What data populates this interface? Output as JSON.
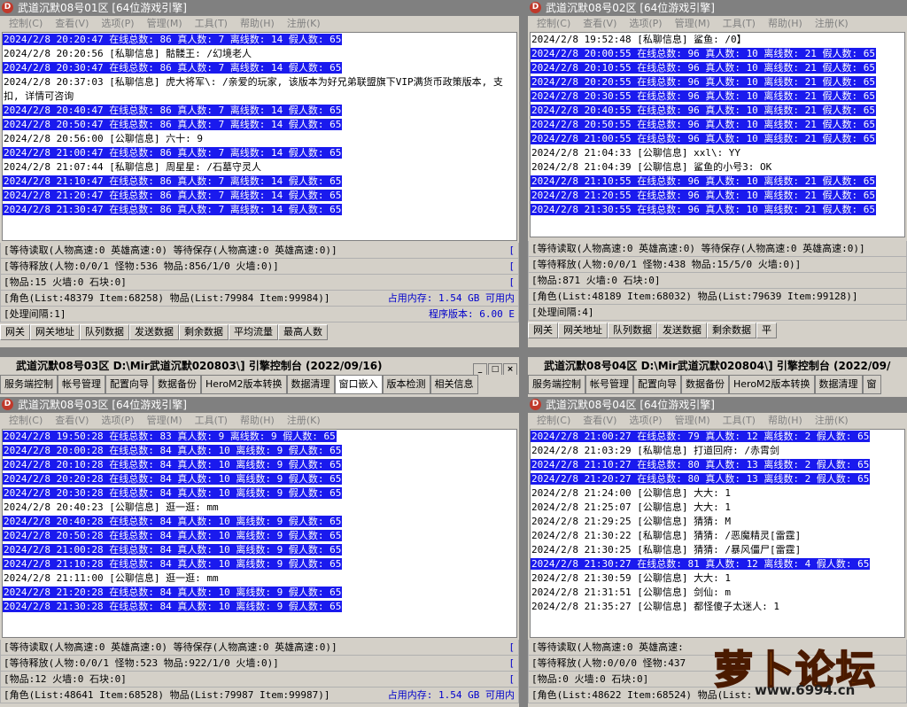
{
  "w1": {
    "title": "武道沉默08号01区 [64位游戏引擎]",
    "menu": [
      "控制(C)",
      "查看(V)",
      "选项(P)",
      "管理(M)",
      "工具(T)",
      "帮助(H)",
      "注册(K)"
    ],
    "log": [
      {
        "t": "2024/2/8 20:20:47 在线总数: 86 真人数: 7 离线数: 14 假人数: 65",
        "hl": true
      },
      {
        "t": "2024/2/8 20:20:56 [私聊信息] 骷髅王: /幻境老人",
        "hl": false
      },
      {
        "t": "2024/2/8 20:30:47 在线总数: 86 真人数: 7 离线数: 14 假人数: 65",
        "hl": true
      },
      {
        "t": "2024/2/8 20:37:03 [私聊信息] 虎大将军\\: /亲爱的玩家, 该版本为好兄弟联盟旗下VIP满货币政策版本, 支",
        "hl": false
      },
      {
        "t": "扣, 详情可咨询",
        "hl": false
      },
      {
        "t": "2024/2/8 20:40:47 在线总数: 86 真人数: 7 离线数: 14 假人数: 65",
        "hl": true
      },
      {
        "t": "2024/2/8 20:50:47 在线总数: 86 真人数: 7 离线数: 14 假人数: 65",
        "hl": true
      },
      {
        "t": "2024/2/8 20:56:00 [公聊信息] 六十: 9",
        "hl": false
      },
      {
        "t": "2024/2/8 21:00:47 在线总数: 86 真人数: 7 离线数: 14 假人数: 65",
        "hl": true
      },
      {
        "t": "2024/2/8 21:07:44 [私聊信息] 周星星: /石墓守灵人",
        "hl": false
      },
      {
        "t": "2024/2/8 21:10:47 在线总数: 86 真人数: 7 离线数: 14 假人数: 65",
        "hl": true
      },
      {
        "t": "2024/2/8 21:20:47 在线总数: 86 真人数: 7 离线数: 14 假人数: 65",
        "hl": true
      },
      {
        "t": "2024/2/8 21:30:47 在线总数: 86 真人数: 7 离线数: 14 假人数: 65",
        "hl": true
      }
    ],
    "status": [
      {
        "l": "[等待读取(人物高速:0 英雄高速:0) 等待保存(人物高速:0 英雄高速:0)]",
        "r": "["
      },
      {
        "l": "[等待释放(人物:0/0/1 怪物:536 物品:856/1/0 火墙:0)]",
        "r": "["
      },
      {
        "l": "[物品:15 火墙:0 石块:0]",
        "r": "["
      },
      {
        "l": "[角色(List:48379 Item:68258) 物品(List:79984 Item:99984)]",
        "r": "占用内存: 1.54 GB 可用内"
      },
      {
        "l": "[处理间隔:1]",
        "r": "程序版本: 6.00 E"
      }
    ],
    "cols": [
      "网关",
      "网关地址",
      "队列数据",
      "发送数据",
      "剩余数据",
      "平均流量",
      "最高人数"
    ]
  },
  "w2": {
    "title": "武道沉默08号02区 [64位游戏引擎]",
    "menu": [
      "控制(C)",
      "查看(V)",
      "选项(P)",
      "管理(M)",
      "工具(T)",
      "帮助(H)",
      "注册(K)"
    ],
    "log": [
      {
        "t": "2024/2/8 19:52:48 [私聊信息] 鲨鱼: /0】",
        "hl": false
      },
      {
        "t": "2024/2/8 20:00:55 在线总数: 96 真人数: 10 离线数: 21 假人数: 65",
        "hl": true
      },
      {
        "t": "2024/2/8 20:10:55 在线总数: 96 真人数: 10 离线数: 21 假人数: 65",
        "hl": true
      },
      {
        "t": "2024/2/8 20:20:55 在线总数: 96 真人数: 10 离线数: 21 假人数: 65",
        "hl": true
      },
      {
        "t": "2024/2/8 20:30:55 在线总数: 96 真人数: 10 离线数: 21 假人数: 65",
        "hl": true
      },
      {
        "t": "2024/2/8 20:40:55 在线总数: 96 真人数: 10 离线数: 21 假人数: 65",
        "hl": true
      },
      {
        "t": "2024/2/8 20:50:55 在线总数: 96 真人数: 10 离线数: 21 假人数: 65",
        "hl": true
      },
      {
        "t": "2024/2/8 21:00:55 在线总数: 96 真人数: 10 离线数: 21 假人数: 65",
        "hl": true
      },
      {
        "t": "2024/2/8 21:04:33 [公聊信息] xxl\\: YY",
        "hl": false
      },
      {
        "t": "2024/2/8 21:04:39 [公聊信息] 鲨鱼的小号3: OK",
        "hl": false
      },
      {
        "t": "2024/2/8 21:10:55 在线总数: 96 真人数: 10 离线数: 21 假人数: 65",
        "hl": true
      },
      {
        "t": "2024/2/8 21:20:55 在线总数: 96 真人数: 10 离线数: 21 假人数: 65",
        "hl": true
      },
      {
        "t": "2024/2/8 21:30:55 在线总数: 96 真人数: 10 离线数: 21 假人数: 65",
        "hl": true
      }
    ],
    "status": [
      {
        "l": "[等待读取(人物高速:0 英雄高速:0) 等待保存(人物高速:0 英雄高速:0)]",
        "r": ""
      },
      {
        "l": "[等待释放(人物:0/0/1 怪物:438 物品:15/5/0 火墙:0)]",
        "r": ""
      },
      {
        "l": "[物品:871 火墙:0 石块:0]",
        "r": ""
      },
      {
        "l": "[角色(List:48189 Item:68032) 物品(List:79639 Item:99128)]",
        "r": ""
      },
      {
        "l": "[处理间隔:4]",
        "r": ""
      }
    ],
    "cols": [
      "网关",
      "网关地址",
      "队列数据",
      "发送数据",
      "剩余数据",
      "平"
    ]
  },
  "w3": {
    "outer_title": "武道沉默08号03区 D:\\Mir武道沉默020803\\] 引擎控制台 (2022/09/16)",
    "tabs": [
      "服务端控制",
      "帐号管理",
      "配置向导",
      "数据备份",
      "HeroM2版本转换",
      "数据清理",
      "窗口嵌入",
      "版本检测",
      "相关信息"
    ],
    "title": "武道沉默08号03区 [64位游戏引擎]",
    "menu": [
      "控制(C)",
      "查看(V)",
      "选项(P)",
      "管理(M)",
      "工具(T)",
      "帮助(H)",
      "注册(K)"
    ],
    "log": [
      {
        "t": "2024/2/8 19:50:28 在线总数: 83 真人数: 9 离线数: 9 假人数: 65",
        "hl": true
      },
      {
        "t": "2024/2/8 20:00:28 在线总数: 84 真人数: 10 离线数: 9 假人数: 65",
        "hl": true
      },
      {
        "t": "2024/2/8 20:10:28 在线总数: 84 真人数: 10 离线数: 9 假人数: 65",
        "hl": true
      },
      {
        "t": "2024/2/8 20:20:28 在线总数: 84 真人数: 10 离线数: 9 假人数: 65",
        "hl": true
      },
      {
        "t": "2024/2/8 20:30:28 在线总数: 84 真人数: 10 离线数: 9 假人数: 65",
        "hl": true
      },
      {
        "t": "2024/2/8 20:40:23 [公聊信息] 逛一逛: mm",
        "hl": false
      },
      {
        "t": "2024/2/8 20:40:28 在线总数: 84 真人数: 10 离线数: 9 假人数: 65",
        "hl": true
      },
      {
        "t": "2024/2/8 20:50:28 在线总数: 84 真人数: 10 离线数: 9 假人数: 65",
        "hl": true
      },
      {
        "t": "2024/2/8 21:00:28 在线总数: 84 真人数: 10 离线数: 9 假人数: 65",
        "hl": true
      },
      {
        "t": "2024/2/8 21:10:28 在线总数: 84 真人数: 10 离线数: 9 假人数: 65",
        "hl": true
      },
      {
        "t": "2024/2/8 21:11:00 [公聊信息] 逛一逛: mm",
        "hl": false
      },
      {
        "t": "2024/2/8 21:20:28 在线总数: 84 真人数: 10 离线数: 9 假人数: 65",
        "hl": true
      },
      {
        "t": "2024/2/8 21:30:28 在线总数: 84 真人数: 10 离线数: 9 假人数: 65",
        "hl": true
      }
    ],
    "status": [
      {
        "l": "[等待读取(人物高速:0 英雄高速:0) 等待保存(人物高速:0 英雄高速:0)]",
        "r": "["
      },
      {
        "l": "[等待释放(人物:0/0/1 怪物:523 物品:922/1/0 火墙:0)]",
        "r": "["
      },
      {
        "l": "[物品:12 火墙:0 石块:0]",
        "r": "["
      },
      {
        "l": "[角色(List:48641 Item:68528) 物品(List:79987 Item:99987)]",
        "r": "占用内存: 1.54 GB 可用内"
      }
    ]
  },
  "w4": {
    "outer_title": "武道沉默08号04区 D:\\Mir武道沉默020804\\] 引擎控制台 (2022/09/",
    "tabs": [
      "服务端控制",
      "帐号管理",
      "配置向导",
      "数据备份",
      "HeroM2版本转换",
      "数据清理",
      "窗"
    ],
    "title": "武道沉默08号04区 [64位游戏引擎]",
    "menu": [
      "控制(C)",
      "查看(V)",
      "选项(P)",
      "管理(M)",
      "工具(T)",
      "帮助(H)",
      "注册(K)"
    ],
    "log": [
      {
        "t": "2024/2/8 21:00:27 在线总数: 79 真人数: 12 离线数: 2 假人数: 65",
        "hl": true
      },
      {
        "t": "2024/2/8 21:03:29 [私聊信息] 打道回府: /赤霄剑",
        "hl": false
      },
      {
        "t": "2024/2/8 21:10:27 在线总数: 80 真人数: 13 离线数: 2 假人数: 65",
        "hl": true
      },
      {
        "t": "2024/2/8 21:20:27 在线总数: 80 真人数: 13 离线数: 2 假人数: 65",
        "hl": true
      },
      {
        "t": "2024/2/8 21:24:00 [公聊信息] 大大: 1",
        "hl": false
      },
      {
        "t": "2024/2/8 21:25:07 [公聊信息] 大大: 1",
        "hl": false
      },
      {
        "t": "2024/2/8 21:29:25 [公聊信息] 猜猜: M",
        "hl": false
      },
      {
        "t": "2024/2/8 21:30:22 [私聊信息] 猜猜: /恶魔精灵[雷霆]",
        "hl": false
      },
      {
        "t": "2024/2/8 21:30:25 [私聊信息] 猜猜: /暴风僵尸[雷霆]",
        "hl": false
      },
      {
        "t": "2024/2/8 21:30:27 在线总数: 81 真人数: 12 离线数: 4 假人数: 65",
        "hl": true
      },
      {
        "t": "2024/2/8 21:30:59 [公聊信息] 大大: 1",
        "hl": false
      },
      {
        "t": "2024/2/8 21:31:51 [公聊信息] 剑仙: m",
        "hl": false
      },
      {
        "t": "2024/2/8 21:35:27 [公聊信息] 都怪傻子太迷人: 1",
        "hl": false
      }
    ],
    "status": [
      {
        "l": "[等待读取(人物高速:0 英雄高速:",
        "r": ""
      },
      {
        "l": "[等待释放(人物:0/0/0 怪物:437",
        "r": ""
      },
      {
        "l": "[物品:0 火墙:0 石块:0]",
        "r": ""
      },
      {
        "l": "[角色(List:48622 Item:68524) 物品(List:",
        "r": ""
      }
    ]
  },
  "watermark": {
    "text": "萝卜论坛",
    "url": "www.6994.cn"
  }
}
